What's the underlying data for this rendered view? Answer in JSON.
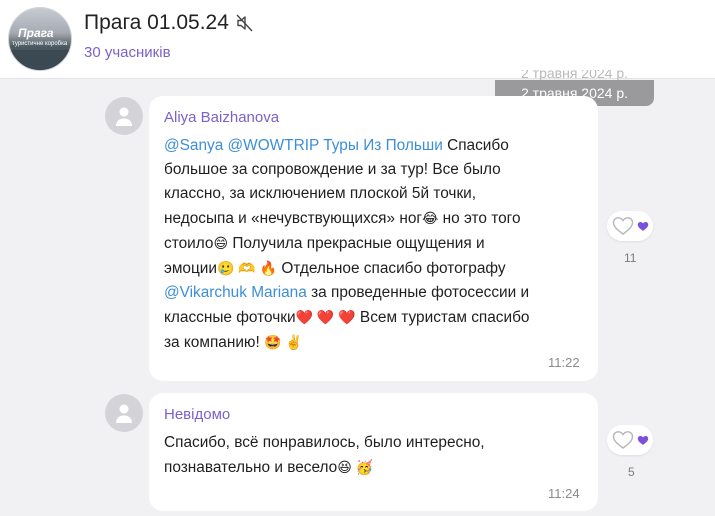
{
  "chat": {
    "title": "Прага 01.05.24",
    "subtitle": "30 учасників",
    "avatar_text_main": "Прага",
    "avatar_text_sub": "туристичне коробка",
    "muted_icon": "speaker-muted-icon"
  },
  "date_separator": {
    "label": "2 травня 2024 р.",
    "ghost_label": "2 травня 2024 р."
  },
  "messages": [
    {
      "sender": "Aliya Baizhanova",
      "lines": [
        {
          "mention": "@Sanya @WOWTRIP Туры Из Польши",
          "text": " Спасибо"
        },
        {
          "text": "большое за сопровождение и за тур! Все было"
        },
        {
          "text": "классно, за исключением плоской 5й точки,"
        },
        {
          "text": "недосыпа и «нечувствующихся» ног",
          "emoji": "😂",
          "text2": "  но это того"
        },
        {
          "text": "стоило",
          "emoji": "😄",
          "text2": "  Получила прекрасные ощущения и"
        },
        {
          "text": "эмоции",
          "emoji": "🥲 🫶 🔥",
          "text2": "  Отдельное спасибо фотографу"
        },
        {
          "mention": "@Vikarchuk Mariana",
          "text": " за проведенные фотосессии и"
        },
        {
          "text": "классные фоточки",
          "emoji": "❤️ ❤️ ❤️",
          "text2": "  Всем туристам спасибо"
        },
        {
          "text": "за компанию! ",
          "emoji": "🤩 ✌️"
        }
      ],
      "time": "11:22",
      "reactions": {
        "count": "11"
      }
    },
    {
      "sender": "Невідомо",
      "lines": [
        {
          "text": "Спасибо, всё понравилось, было интересно,"
        },
        {
          "text": "познавательно и весело",
          "emoji": "😆 🥳"
        }
      ],
      "time": "11:24",
      "reactions": {
        "count": "5"
      }
    }
  ],
  "colors": {
    "accent": "#7b61c9",
    "mention": "#3d8ed6",
    "background": "#f1f1f3",
    "bubble": "#ffffff",
    "date_pill": "#9a9a9c",
    "reaction_heart": "#7b4fe0"
  }
}
